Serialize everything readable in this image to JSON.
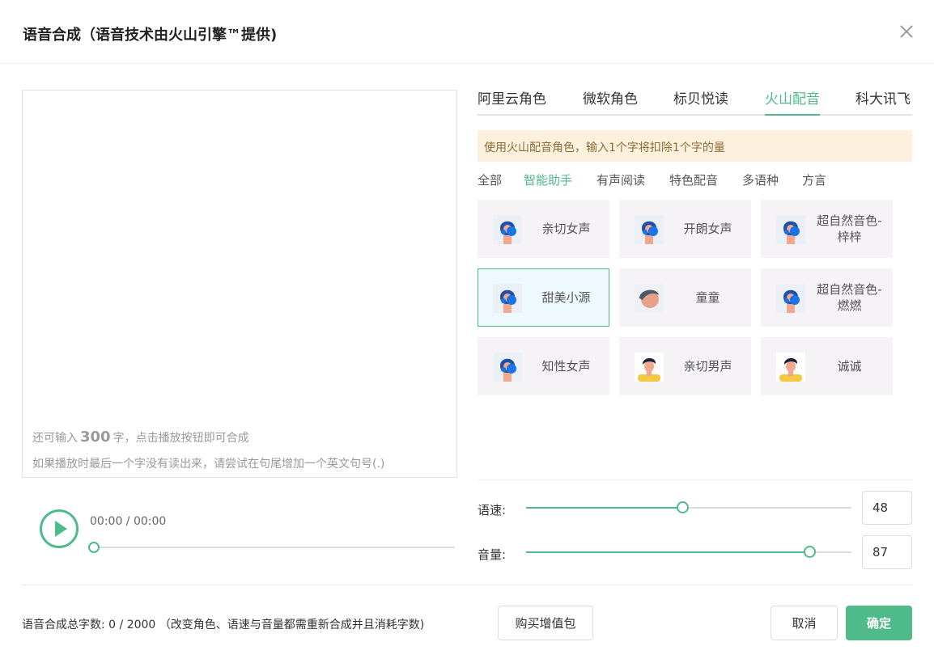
{
  "dialog": {
    "title": "语音合成（语音技术由火山引擎™提供)",
    "close_icon": "close-icon"
  },
  "editor": {
    "value": "",
    "remaining_prefix": "还可输入",
    "remaining_count": "300",
    "remaining_suffix": "字，点击播放按钮即可合成",
    "tip": "如果播放时最后一个字没有读出来，请尝试在句尾增加一个英文句号(.)"
  },
  "player": {
    "time": "00:00 / 00:00",
    "progress": 0
  },
  "provider_tabs": [
    {
      "label": "阿里云角色"
    },
    {
      "label": "微软角色"
    },
    {
      "label": "标贝悦读"
    },
    {
      "label": "火山配音",
      "active": true
    },
    {
      "label": "科大讯飞"
    }
  ],
  "notice": "使用火山配音角色，输入1个字将扣除1个字的量",
  "categories": [
    {
      "label": "全部"
    },
    {
      "label": "智能助手",
      "active": true
    },
    {
      "label": "有声阅读"
    },
    {
      "label": "特色配音"
    },
    {
      "label": "多语种"
    },
    {
      "label": "方言"
    }
  ],
  "voices": [
    {
      "name": "亲切女声",
      "avatar": "female-avatar-icon"
    },
    {
      "name": "开朗女声",
      "avatar": "female-avatar-icon"
    },
    {
      "name": "超自然音色-梓梓",
      "avatar": "female-avatar-icon"
    },
    {
      "name": "甜美小源",
      "avatar": "female-avatar-icon",
      "selected": true
    },
    {
      "name": "童童",
      "avatar": "child-avatar-icon"
    },
    {
      "name": "超自然音色-燃燃",
      "avatar": "female-avatar-icon"
    },
    {
      "name": "知性女声",
      "avatar": "female-avatar-icon"
    },
    {
      "name": "亲切男声",
      "avatar": "male-avatar-icon"
    },
    {
      "name": "诚诚",
      "avatar": "male-avatar-icon"
    }
  ],
  "speed": {
    "label": "语速:",
    "value": "48",
    "level": 0.48
  },
  "volume": {
    "label": "音量:",
    "value": "87",
    "level": 0.87
  },
  "footer": {
    "total_label": "语音合成总字数:",
    "total_value": "0 / 2000",
    "total_note": "（改变角色、语速与音量都需重新合成并且消耗字数)",
    "buy_label": "购买增值包",
    "cancel_label": "取消",
    "confirm_label": "确定"
  },
  "colors": {
    "accent": "#4fba8a",
    "notice_bg": "#fdf0dc",
    "selected_bg": "#eef8ff"
  }
}
